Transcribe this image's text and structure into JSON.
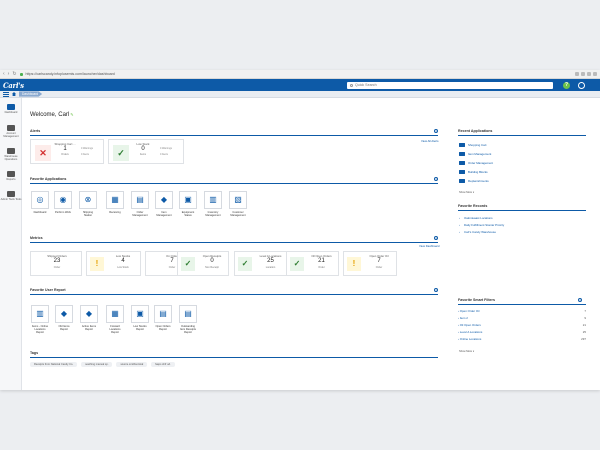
{
  "browser": {
    "url": "https://carlscandy.infoplusemis.com/launcher/dashboard"
  },
  "app": {
    "logo": "Carl's",
    "search_placeholder": "Quick Search",
    "help_label": "?",
    "breadcrumb": "Dashboard"
  },
  "sidebar": {
    "items": [
      {
        "label": "Dashboard",
        "icon": "dashboard-icon"
      },
      {
        "label": "Account Management",
        "icon": "users-icon"
      },
      {
        "label": "Warehouse Operations",
        "icon": "warehouse-icon"
      },
      {
        "label": "Reports",
        "icon": "report-icon"
      },
      {
        "label": "Admin Tools Tools",
        "icon": "tools-icon"
      }
    ]
  },
  "welcome": "Welcome, Carl",
  "alerts": {
    "title": "Alerts",
    "view_all": "View All Alerts",
    "items": [
      {
        "title": "Shopping Cart ...",
        "count": "1",
        "unit": "Orders",
        "warn1": "0 Warnings",
        "warn2": "0 Alerts",
        "status": "x"
      },
      {
        "title": "Low Stock",
        "count": "0",
        "unit": "Items",
        "warn1": "0 Warnings",
        "warn2": "0 Alerts",
        "status": "check"
      }
    ]
  },
  "favorite_applications": {
    "title": "Favorite Applications",
    "items": [
      {
        "label": "Dashboard",
        "icon": "globe-icon",
        "glyph": "◎"
      },
      {
        "label": "Perform Work",
        "icon": "checklist-icon",
        "glyph": "◉"
      },
      {
        "label": "Shipping Station",
        "icon": "gear-icon",
        "glyph": "⊗"
      },
      {
        "label": "Receiving",
        "icon": "pallet-icon",
        "glyph": "▦"
      },
      {
        "label": "Order Management",
        "icon": "clipboard-icon",
        "glyph": "▤"
      },
      {
        "label": "Item Management",
        "icon": "boxes-icon",
        "glyph": "◆"
      },
      {
        "label": "Equipment Status",
        "icon": "truck-icon",
        "glyph": "▣"
      },
      {
        "label": "Inventory Management",
        "icon": "forklift-icon",
        "glyph": "▥"
      },
      {
        "label": "Customer Management",
        "icon": "customer-icon",
        "glyph": "▧"
      }
    ]
  },
  "metrics": {
    "title": "Metrics",
    "view_link": "View Dashboard",
    "items": [
      {
        "title": "Shipped Orders",
        "value": "23",
        "unit": "Order",
        "status": "none"
      },
      {
        "title": "Low Stocks",
        "value": "4",
        "unit": "Low Stock",
        "status": "excl"
      },
      {
        "title": "On Order",
        "value": "7",
        "unit": "Order",
        "status": "none"
      },
      {
        "title": "Open Receipts",
        "value": "0",
        "unit": "Non Receipt",
        "status": "check"
      },
      {
        "title": "Level A Locations",
        "value": "25",
        "unit": "Location",
        "status": "check"
      },
      {
        "title": "Oil Open Orders",
        "value": "21",
        "unit": "Order",
        "status": "check"
      },
      {
        "title": "Open Order Oil",
        "value": "7",
        "unit": "Order",
        "status": "excl"
      }
    ]
  },
  "favorite_user_report": {
    "title": "Favorite User Report",
    "items": [
      {
        "label": "Items - Online Locations Report",
        "icon": "barcode-icon",
        "glyph": "▥"
      },
      {
        "label": "Old Items Report",
        "icon": "boxes-icon",
        "glyph": "◆"
      },
      {
        "label": "Active Items Report",
        "icon": "boxes-icon",
        "glyph": "◆"
      },
      {
        "label": "Forward Locations Report",
        "icon": "pallet-icon",
        "glyph": "▦"
      },
      {
        "label": "Low Stocks Report",
        "icon": "truck-icon",
        "glyph": "▣"
      },
      {
        "label": "Open Orders Report",
        "icon": "clipboard-icon",
        "glyph": "▤"
      },
      {
        "label": "Outstanding Item Receipts Report",
        "icon": "receipt-icon",
        "glyph": "▤"
      }
    ]
  },
  "tags": {
    "title": "Tags",
    "items": [
      "Receipts from National Candy Co.",
      "seething manual sp.",
      "source.smithsonical",
      "fasps shfr ud."
    ]
  },
  "recent_applications": {
    "title": "Recent Applications",
    "items": [
      {
        "label": "Shopping Cart",
        "icon": "cart-icon"
      },
      {
        "label": "Item Management",
        "icon": "boxes-icon"
      },
      {
        "label": "Order Management",
        "icon": "clipboard-icon"
      },
      {
        "label": "Building Blocks",
        "icon": "blocks-icon"
      },
      {
        "label": "Replenishments",
        "icon": "replenish-icon"
      }
    ],
    "show_more": "Show More"
  },
  "favorite_records": {
    "title": "Favorite Records",
    "items": [
      "Oakmleaast Locations",
      "Daily Fulfillment Stoniar Priority",
      "Carl's Candy Warehouse"
    ],
    "show_more": "Show More"
  },
  "favorite_smart_filters": {
    "title": "Favorite Smart Filters",
    "items": [
      {
        "label": "Open Order Oil",
        "count": "7"
      },
      {
        "label": "Item 2",
        "count": "9"
      },
      {
        "label": "Oil Open Orders",
        "count": "21"
      },
      {
        "label": "Level A Locations",
        "count": "25"
      },
      {
        "label": "Online Locations",
        "count": "297"
      }
    ],
    "show_more": "Show More"
  }
}
